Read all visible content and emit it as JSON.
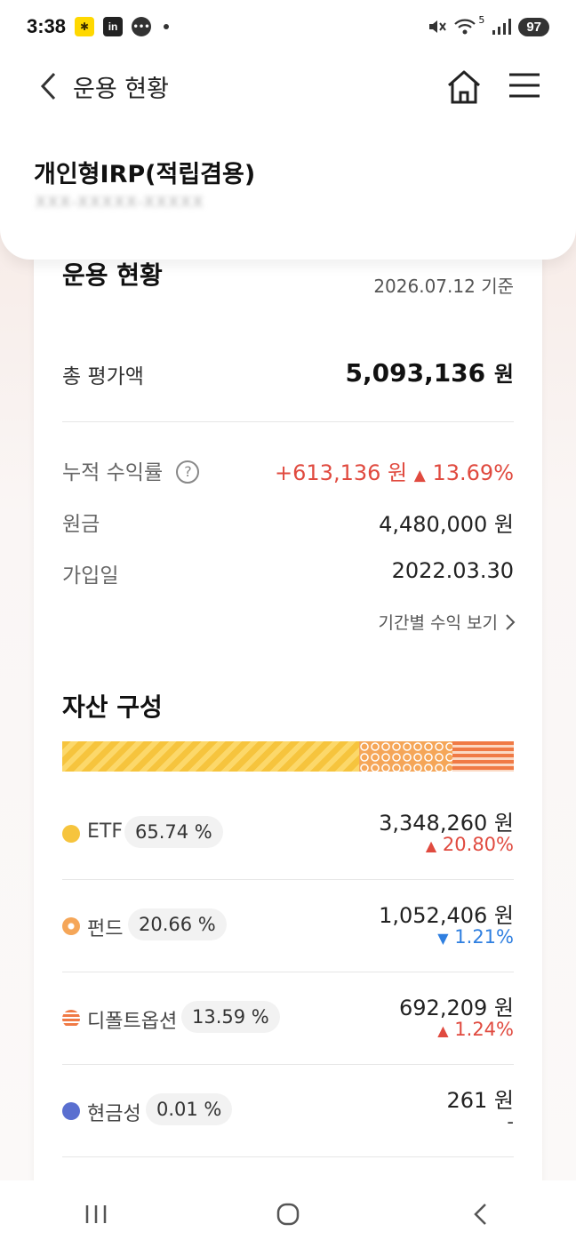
{
  "status_bar": {
    "time": "3:38",
    "battery": "97",
    "signal_label": "5"
  },
  "header": {
    "title": "운용 현황",
    "account_name": "개인형IRP(적립겸용)",
    "account_number_masked": "XXX-XXXXX-XXXXX"
  },
  "summary": {
    "title": "운용 현황",
    "ref_date": "2026.07.12 기준",
    "total_label": "총 평가액",
    "total_value": "5,093,136",
    "unit": "원",
    "cumulative_label": "누적 수익률",
    "cumulative_amount": "+613,136",
    "cumulative_rate": "13.69%",
    "principal_label": "원금",
    "principal_value": "4,480,000",
    "join_label": "가입일",
    "join_date": "2022.03.30",
    "period_link": "기간별 수익 보기"
  },
  "composition": {
    "title": "자산 구성",
    "shares": [
      0.6574,
      0.2066,
      0.1359,
      0.0001
    ],
    "assets": [
      {
        "name": "ETF",
        "pct": "65.74 %",
        "amount": "3,348,260",
        "change": "20.80%",
        "direction": "up"
      },
      {
        "name": "펀드",
        "pct": "20.66 %",
        "amount": "1,052,406",
        "change": "1.21%",
        "direction": "down"
      },
      {
        "name": "디폴트옵션",
        "pct": "13.59 %",
        "amount": "692,209",
        "change": "1.24%",
        "direction": "up"
      },
      {
        "name": "현금성",
        "pct": "0.01 %",
        "amount": "261",
        "change": "-",
        "direction": "none"
      }
    ]
  },
  "colors": {
    "accent_red": "#e04a3f",
    "accent_blue": "#2f7fe0",
    "etf": "#f6c43d",
    "fund": "#f5a658",
    "default_option": "#f07a45",
    "cash": "#5a6fd0"
  }
}
